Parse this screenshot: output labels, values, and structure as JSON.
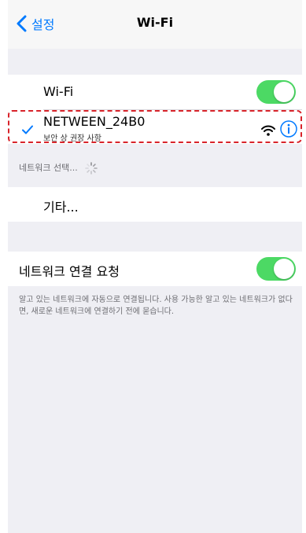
{
  "nav": {
    "back_label": "설정",
    "title": "Wi-Fi"
  },
  "wifi": {
    "label": "Wi-Fi",
    "enabled": true
  },
  "connected_network": {
    "name": "NETWEEN_24B0",
    "subtitle": "보안 상 권장 사항"
  },
  "network_select": {
    "header": "네트워크 선택...",
    "other_label": "기타..."
  },
  "ask_to_join": {
    "label": "네트워크 연결 요청",
    "enabled": true,
    "footer": "알고 있는 네트워크에 자동으로 연결됩니다. 사용 가능한 알고 있는 네트워크가 없다면, 새로운 네트워크에 연결하기 전에 묻습니다."
  },
  "colors": {
    "accent": "#007aff",
    "toggle_on": "#4cd964",
    "highlight": "#d8232a"
  }
}
